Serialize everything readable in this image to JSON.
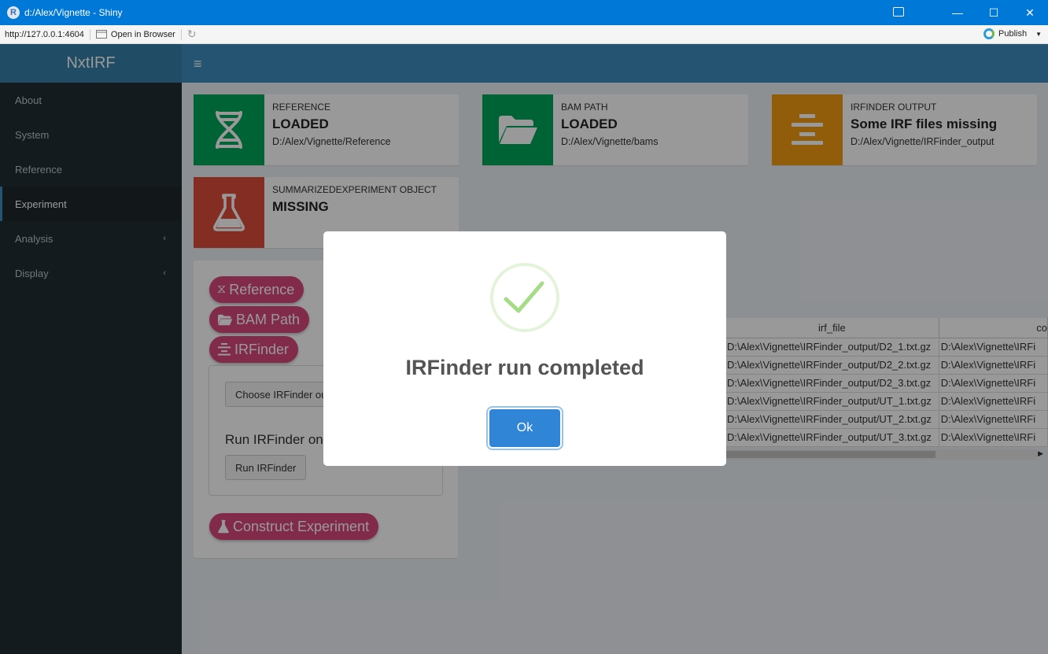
{
  "window": {
    "title": "d:/Alex/Vignette - Shiny",
    "url": "http://127.0.0.1:4604",
    "open_in_browser": "Open in Browser",
    "publish": "Publish",
    "controls": {
      "minimize": "—",
      "maximize": "☐",
      "close": "✕"
    }
  },
  "app": {
    "brand": "NxtIRF",
    "menu_icon": "≡"
  },
  "sidebar": {
    "items": [
      {
        "label": "About"
      },
      {
        "label": "System"
      },
      {
        "label": "Reference"
      },
      {
        "label": "Experiment"
      },
      {
        "label": "Analysis",
        "chevron": "‹"
      },
      {
        "label": "Display",
        "chevron": "‹"
      }
    ],
    "active": "Experiment"
  },
  "infoboxes": [
    {
      "label": "REFERENCE",
      "value": "LOADED",
      "path": "D:/Alex/Vignette/Reference",
      "color": "#00a65a",
      "icon": "dna-icon"
    },
    {
      "label": "BAM PATH",
      "value": "LOADED",
      "path": "D:/Alex/Vignette/bams",
      "color": "#00a65a",
      "icon": "folder-open-icon"
    },
    {
      "label": "IRFINDER OUTPUT",
      "value": "Some IRF files missing",
      "path": "D:/Alex/Vignette/IRFinder_output",
      "color": "#f39c12",
      "icon": "align-center-icon"
    },
    {
      "label": "SUMMARIZEDEXPERIMENT OBJECT",
      "value": "MISSING",
      "path": "",
      "color": "#dd4b39",
      "icon": "flask-icon"
    }
  ],
  "panel": {
    "pills": {
      "reference": "Reference",
      "bam_path": "BAM Path",
      "irfinder": "IRFinder",
      "construct": "Construct Experiment"
    },
    "choose_button": "Choose IRFinder ou",
    "run_label": "Run IRFinder on",
    "run_button": "Run IRFinder",
    "accent": "#d9467a"
  },
  "table": {
    "headers": [
      "irf_file",
      "co"
    ],
    "rows": [
      [
        "D:\\Alex\\Vignette\\IRFinder_output/D2_1.txt.gz",
        "D:\\Alex\\Vignette\\IRFi"
      ],
      [
        "D:\\Alex\\Vignette\\IRFinder_output/D2_2.txt.gz",
        "D:\\Alex\\Vignette\\IRFi"
      ],
      [
        "D:\\Alex\\Vignette\\IRFinder_output/D2_3.txt.gz",
        "D:\\Alex\\Vignette\\IRFi"
      ],
      [
        "D:\\Alex\\Vignette\\IRFinder_output/UT_1.txt.gz",
        "D:\\Alex\\Vignette\\IRFi"
      ],
      [
        "D:\\Alex\\Vignette\\IRFinder_output/UT_2.txt.gz",
        "D:\\Alex\\Vignette\\IRFi"
      ],
      [
        "D:\\Alex\\Vignette\\IRFinder_output/UT_3.txt.gz",
        "D:\\Alex\\Vignette\\IRFi"
      ]
    ]
  },
  "modal": {
    "message": "IRFinder run completed",
    "ok_label": "Ok",
    "icon": "success-check-icon",
    "button_color": "#3085d6"
  }
}
